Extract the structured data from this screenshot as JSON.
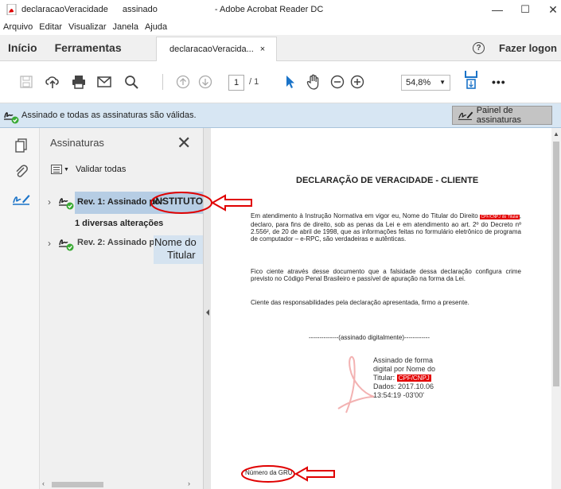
{
  "window": {
    "file_name": "declaracaoVeracidade",
    "file_suffix": "assinado",
    "app_name": "- Adobe Acrobat Reader DC",
    "minimize": "—",
    "maximize": "☐",
    "close": "✕"
  },
  "menu": [
    "Arquivo",
    "Editar",
    "Visualizar",
    "Janela",
    "Ajuda"
  ],
  "tabs": {
    "home": "Início",
    "tools": "Ferramentas",
    "document": "declaracaoVeracida...",
    "document_close": "×",
    "help": "?",
    "logon": "Fazer logon"
  },
  "toolbar": {
    "page_current": "1",
    "page_total": "/ 1",
    "zoom": "54,8%",
    "more": "•••"
  },
  "signature_bar": {
    "message": "Assinado e todas as assinaturas são válidas.",
    "panel_button": "Painel de assinaturas"
  },
  "signatures_panel": {
    "title": "Assinaturas",
    "close": "✕",
    "validate_all": "Validar todas",
    "rev1_label": "Rev. 1: Assinado por",
    "rev1_signer": "INSTITUTO",
    "rev1_changes": "1 diversas alterações",
    "rev2_label": "Rev. 2: Assinado por",
    "rev2_signer_line1": "Nome do",
    "rev2_signer_line2": "Titular"
  },
  "document": {
    "title": "DECLARAÇÃO DE VERACIDADE - CLIENTE",
    "p1_a": "Em atendimento à Instrução Normativa em vigor eu, Nome do Titular do Direito",
    "p1_cpf": "CPF/CNPJ do Titular",
    "p1_b": ", declaro, para fins de direito, sob as penas da Lei e em atendimento ao art. 2º do Decreto nº 2.556², de 20 de abril de 1998, que as informações feitas no formulário eletrônico de programa de computador – e-RPC, são verdadeiras e autênticas.",
    "p2": "Fico ciente através desse documento que a falsidade dessa declaração configura crime previsto no Código Penal Brasileiro e passível de apuração na forma da Lei.",
    "p3": "Ciente das responsabilidades pela declaração apresentada, firmo a presente.",
    "signed_digitally": "--------------(assinado digitalmente)------------",
    "stamp_line1": "Assinado de forma",
    "stamp_line2": "digital por  Nome do",
    "stamp_line3a": "Titular:",
    "stamp_cpf": "CPF/CNPJ",
    "stamp_line4": "Dados: 2017.10.06",
    "stamp_line5": "13:54:19 -03'00'",
    "gru": "Número da GRU"
  },
  "colors": {
    "accent_blue": "#1a73c8",
    "sigbar_bg": "#d7e6f3",
    "highlight": "#b6cde4",
    "annotation_red": "#e00000",
    "valid_green": "#3aaa35"
  }
}
